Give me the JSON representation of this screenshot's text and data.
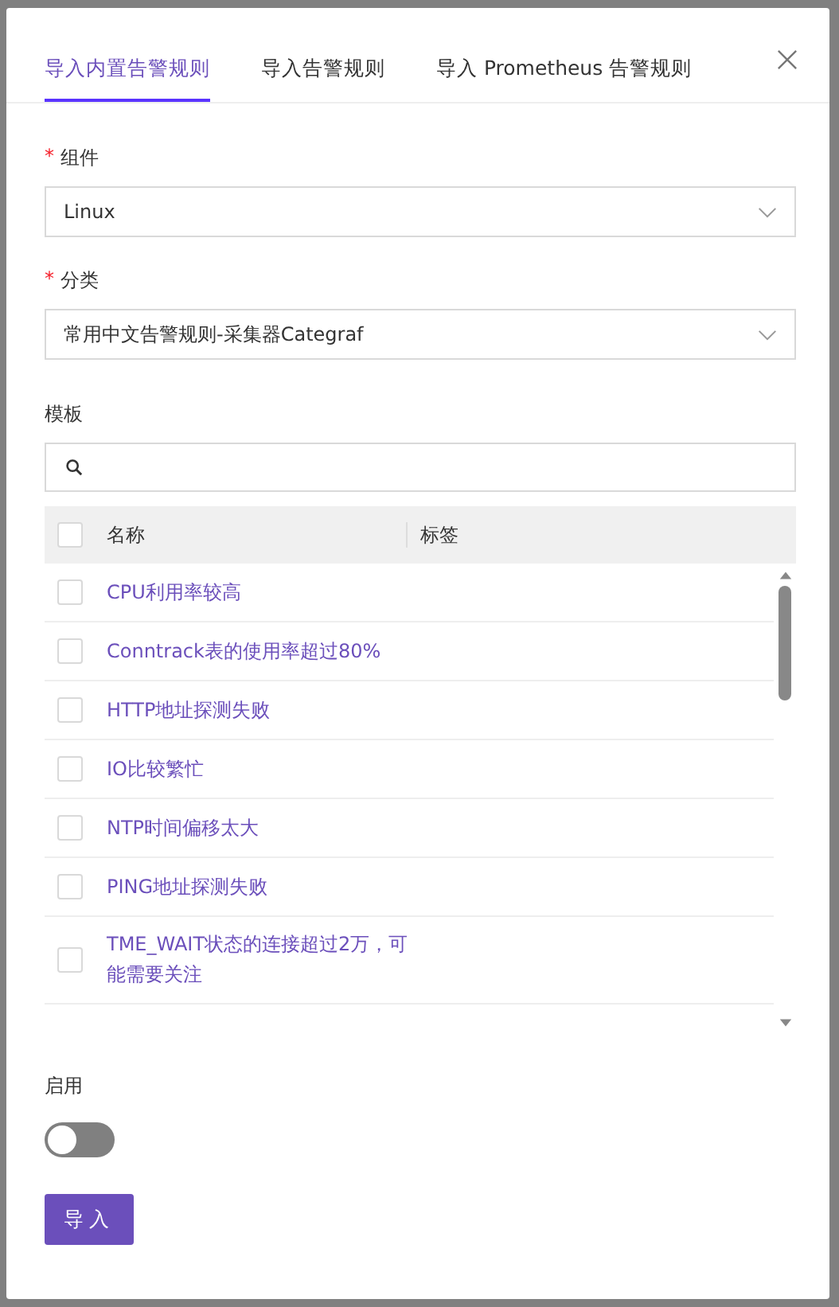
{
  "tabs": [
    {
      "label": "导入内置告警规则",
      "selected": true
    },
    {
      "label": "导入告警规则",
      "selected": false
    },
    {
      "label": "导入 Prometheus 告警规则",
      "selected": false
    }
  ],
  "component": {
    "label": "组件",
    "required_mark": "*",
    "value": "Linux"
  },
  "category": {
    "label": "分类",
    "required_mark": "*",
    "value": "常用中文告警规则-采集器Categraf"
  },
  "template": {
    "label": "模板",
    "columns": [
      "名称",
      "标签"
    ],
    "all_checked": false,
    "rows": [
      {
        "name": "CPU利用率较高",
        "checked": false
      },
      {
        "name": "Conntrack表的使用率超过80%",
        "checked": false
      },
      {
        "name": "HTTP地址探测失败",
        "checked": false
      },
      {
        "name": "IO比较繁忙",
        "checked": false
      },
      {
        "name": "NTP时间偏移太大",
        "checked": false
      },
      {
        "name": "PING地址探测失败",
        "checked": false
      },
      {
        "name": "TME_WAIT状态的连接超过2万，可能需要关注",
        "checked": false
      }
    ]
  },
  "enable": {
    "label": "启用",
    "on": false
  },
  "submit": "导入"
}
